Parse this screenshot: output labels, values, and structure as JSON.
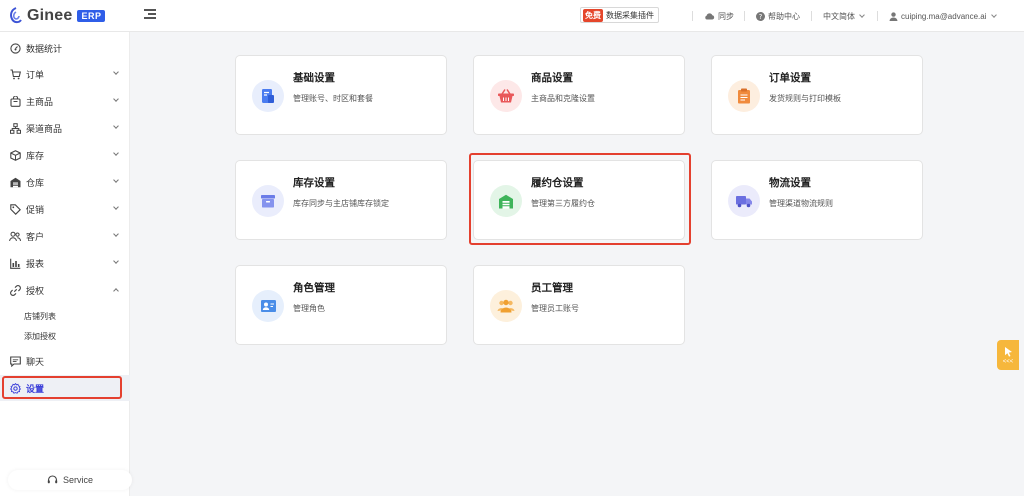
{
  "header": {
    "logo_text": "Ginee",
    "logo_badge": "ERP",
    "plugin_badge": "免费",
    "plugin_label": "数据采集插件",
    "sync_label": "同步",
    "help_label": "帮助中心",
    "language_label": "中文简体",
    "user_email": "cuiping.ma@advance.ai"
  },
  "sidebar": {
    "items": [
      {
        "label": "数据统计",
        "icon": "dashboard-icon"
      },
      {
        "label": "订单",
        "icon": "cart-icon"
      },
      {
        "label": "主商品",
        "icon": "bag-icon"
      },
      {
        "label": "渠道商品",
        "icon": "channel-icon"
      },
      {
        "label": "库存",
        "icon": "box-icon"
      },
      {
        "label": "仓库",
        "icon": "warehouse-icon"
      },
      {
        "label": "促销",
        "icon": "tag-icon"
      },
      {
        "label": "客户",
        "icon": "users-icon"
      },
      {
        "label": "报表",
        "icon": "chart-icon"
      },
      {
        "label": "授权",
        "icon": "link-icon"
      },
      {
        "label": "聊天",
        "icon": "chat-icon"
      },
      {
        "label": "设置",
        "icon": "gear-icon"
      }
    ],
    "sub_items": [
      "店铺列表",
      "添加授权"
    ],
    "service_label": "Service"
  },
  "cards": [
    {
      "title": "基础设置",
      "desc": "管理账号、时区和套餐",
      "icon": "document-icon",
      "color": "#4a7cf0",
      "bg": "#e8eefc"
    },
    {
      "title": "商品设置",
      "desc": "主商品和克隆设置",
      "icon": "basket-icon",
      "color": "#e9585a",
      "bg": "#fde8e8"
    },
    {
      "title": "订单设置",
      "desc": "发货规则与打印模板",
      "icon": "clipboard-icon",
      "color": "#f08a3c",
      "bg": "#fdeedf"
    },
    {
      "title": "库存设置",
      "desc": "库存同步与主店铺库存锁定",
      "icon": "inventory-icon",
      "color": "#6b7ce8",
      "bg": "#eaedfc"
    },
    {
      "title": "履约仓设置",
      "desc": "管理第三方履约仓",
      "icon": "warehouse-icon",
      "color": "#3fb45a",
      "bg": "#e3f5e7"
    },
    {
      "title": "物流设置",
      "desc": "管理渠道物流规则",
      "icon": "truck-icon",
      "color": "#6b6fe0",
      "bg": "#ebebfb"
    },
    {
      "title": "角色管理",
      "desc": "管理角色",
      "icon": "id-card-icon",
      "color": "#4a8de8",
      "bg": "#e6effc"
    },
    {
      "title": "员工管理",
      "desc": "管理员工账号",
      "icon": "team-icon",
      "color": "#f0a030",
      "bg": "#fdf0dc"
    }
  ],
  "side_widget": {
    "label": "<<<"
  },
  "colors": {
    "accent": "#3b3fd9",
    "brand": "#2f5ee8",
    "highlight": "#e4402f"
  }
}
